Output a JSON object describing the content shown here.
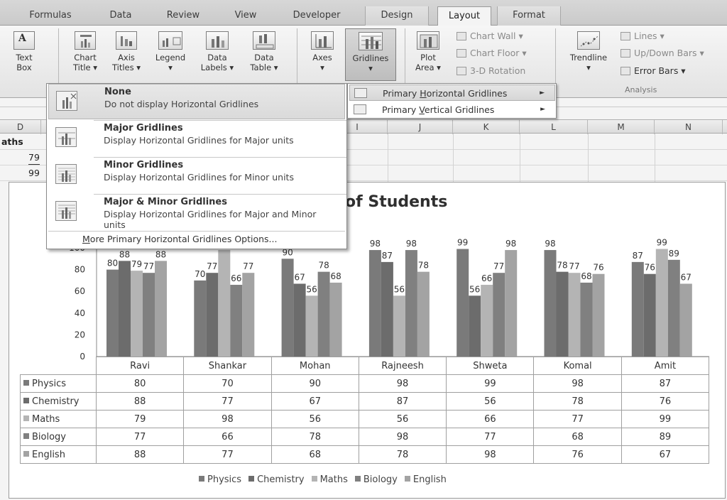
{
  "tabs": [
    "Formulas",
    "Data",
    "Review",
    "View",
    "Developer",
    "Design",
    "Layout",
    "Format"
  ],
  "ribbon": {
    "text_box": [
      "Text",
      "Box"
    ],
    "chart_title": [
      "Chart",
      "Title ▾"
    ],
    "axis_titles": [
      "Axis",
      "Titles ▾"
    ],
    "legend": [
      "Legend",
      "▾"
    ],
    "data_labels": [
      "Data",
      "Labels ▾"
    ],
    "data_table": [
      "Data",
      "Table ▾"
    ],
    "axes": [
      "Axes",
      "▾"
    ],
    "gridlines": [
      "Gridlines",
      "▾"
    ],
    "plot_area": [
      "Plot",
      "Area ▾"
    ],
    "chart_wall": "Chart Wall ▾",
    "chart_floor": "Chart Floor ▾",
    "rotation": "3-D Rotation",
    "trendline": [
      "Trendline",
      "▾"
    ],
    "lines": "Lines ▾",
    "updown_bars": "Up/Down Bars ▾",
    "error_bars": "Error Bars ▾",
    "analysis_label": "Analysis"
  },
  "columns": [
    "D",
    "I",
    "J",
    "K",
    "L",
    "M",
    "N"
  ],
  "cells": {
    "d1": "aths",
    "d2": "79",
    "d3": "99"
  },
  "menu": {
    "items": [
      {
        "title": "None",
        "desc": "Do not display Horizontal Gridlines"
      },
      {
        "title": "Major Gridlines",
        "desc": "Display Horizontal Gridlines for Major units"
      },
      {
        "title": "Minor Gridlines",
        "desc": "Display Horizontal Gridlines for Minor units"
      },
      {
        "title": "Major & Minor Gridlines",
        "desc": "Display Horizontal Gridlines for Major and Minor units"
      }
    ],
    "more_prefix": "M",
    "more_rest": "ore Primary Horizontal Gridlines Options..."
  },
  "submenu": {
    "h_pre": "Primary ",
    "h_u": "H",
    "h_post": "orizontal Gridlines",
    "v_pre": "Primary ",
    "v_u": "V",
    "v_post": "ertical Gridlines",
    "arrow": "►"
  },
  "chart_data": {
    "type": "bar",
    "title": "of Students",
    "categories": [
      "Ravi",
      "Shankar",
      "Mohan",
      "Rajneesh",
      "Shweta",
      "Komal",
      "Amit"
    ],
    "series": [
      {
        "name": "Physics",
        "values": [
          80,
          70,
          90,
          98,
          99,
          98,
          87
        ],
        "color": "#7a7a7a"
      },
      {
        "name": "Chemistry",
        "values": [
          88,
          77,
          67,
          87,
          56,
          78,
          76
        ],
        "color": "#6c6c6c"
      },
      {
        "name": "Maths",
        "values": [
          79,
          98,
          56,
          56,
          66,
          77,
          99
        ],
        "color": "#b4b4b4"
      },
      {
        "name": "Biology",
        "values": [
          77,
          66,
          78,
          98,
          77,
          68,
          89
        ],
        "color": "#808080"
      },
      {
        "name": "English",
        "values": [
          88,
          77,
          68,
          78,
          98,
          76,
          67
        ],
        "color": "#a3a3a3"
      }
    ],
    "y_ticks": [
      "100",
      "80",
      "60",
      "40",
      "20",
      "0"
    ],
    "ylim": [
      0,
      100
    ],
    "legend_position": "bottom",
    "data_table": true
  }
}
